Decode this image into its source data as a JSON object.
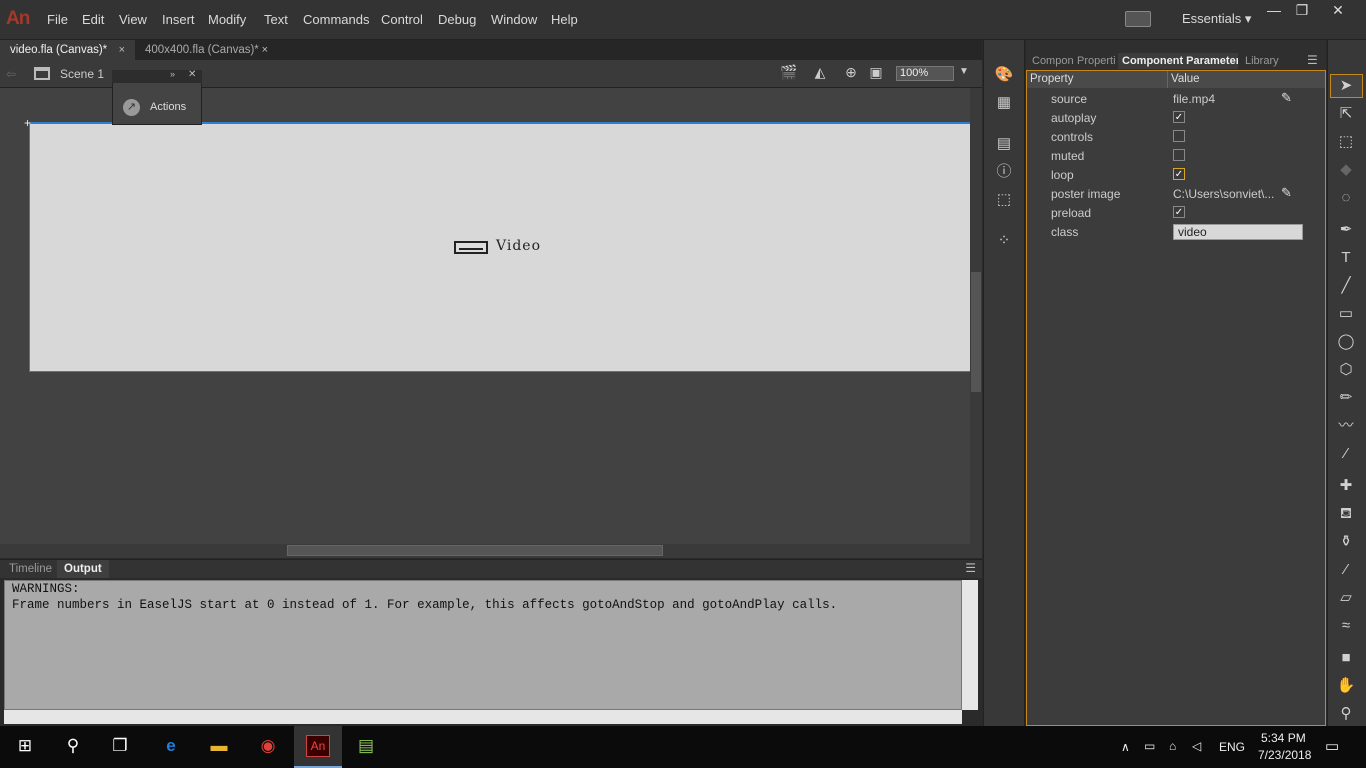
{
  "app": {
    "logo": "An"
  },
  "menu": [
    "File",
    "Edit",
    "View",
    "Insert",
    "Modify",
    "Text",
    "Commands",
    "Control",
    "Debug",
    "Window",
    "Help"
  ],
  "workspace": {
    "label": "Essentials",
    "caret": "▾"
  },
  "window_controls": {
    "minimize": "—",
    "maximize": "❐",
    "close": "✕"
  },
  "doc_tabs": [
    {
      "label": "video.fla (Canvas)*",
      "close": "×"
    },
    {
      "label": "400x400.fla (Canvas)*",
      "close": "×"
    }
  ],
  "editbar": {
    "scene": "Scene 1",
    "zoom": "100%"
  },
  "actions_panel": {
    "label": "Actions"
  },
  "stage": {
    "component_label": "Video"
  },
  "output_panel": {
    "tabs": [
      "Timeline",
      "Output"
    ],
    "lines": [
      "WARNINGS:",
      "Frame numbers in EaselJS start at 0 instead of 1. For example, this affects gotoAndStop and gotoAndPlay calls."
    ]
  },
  "right_tabs": [
    "Compon",
    "Properti",
    "Component Parameters",
    "Library"
  ],
  "params": {
    "header_property": "Property",
    "header_value": "Value",
    "rows": [
      {
        "name": "source",
        "value": "file.mp4"
      },
      {
        "name": "autoplay",
        "checked": true
      },
      {
        "name": "controls",
        "checked": false
      },
      {
        "name": "muted",
        "checked": false
      },
      {
        "name": "loop",
        "checked": true
      },
      {
        "name": "poster image",
        "value": "C:\\Users\\sonviet\\..."
      },
      {
        "name": "preload",
        "checked": true
      },
      {
        "name": "class",
        "value": "video"
      }
    ],
    "check_mark": "✓"
  },
  "taskbar": {
    "lang": "ENG",
    "time": "5:34 PM",
    "date": "7/23/2018",
    "an_label": "An"
  },
  "colors": {
    "accent": "#c4881b",
    "stage_border": "#2c7fd0",
    "logo": "#a4392b"
  }
}
